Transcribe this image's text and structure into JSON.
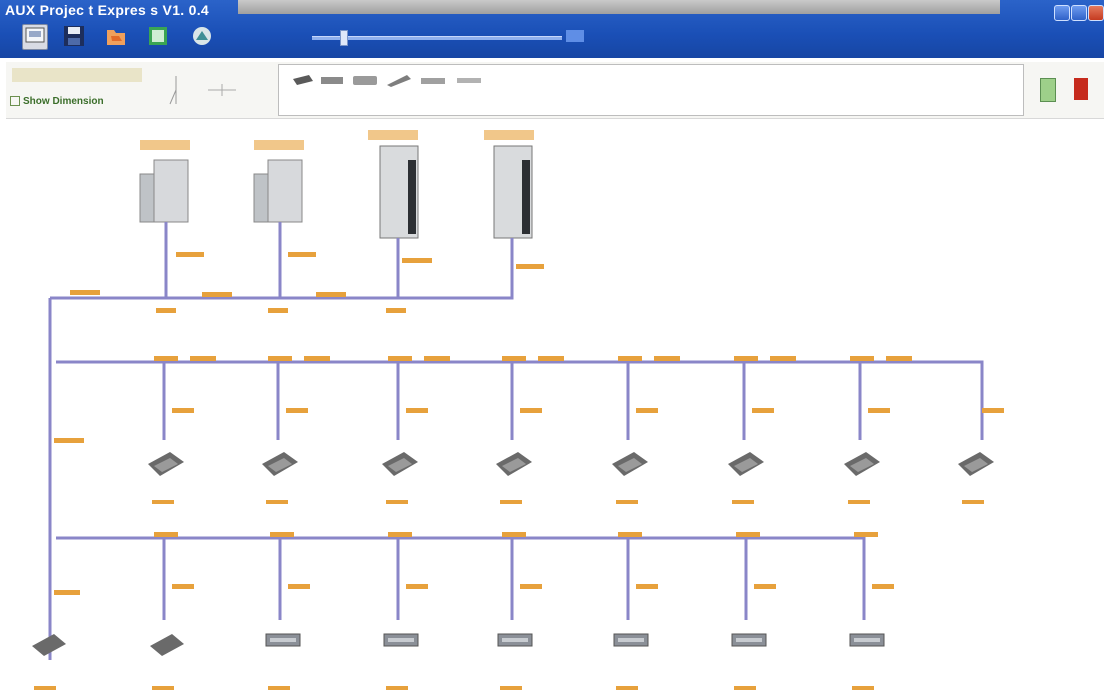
{
  "window": {
    "title": "AUX Projec t Expres s  V1. 0.4"
  },
  "toolbar": {
    "buttons": [
      {
        "name": "new-icon",
        "color": "#d5d9e3"
      },
      {
        "name": "save-icon",
        "color": "#1d2e5c"
      },
      {
        "name": "open-icon",
        "color": "#e36b2a"
      },
      {
        "name": "export-icon",
        "color": "#35a54d"
      },
      {
        "name": "settings-icon",
        "color": "#3f8f95"
      }
    ],
    "zoom_slider": {
      "value_fraction": 0.12
    }
  },
  "palette": {
    "show_dimension_label": "Show Dimension",
    "device_icons": [
      "cassette-unit-icon",
      "duct-unit-icon",
      "wall-unit-icon",
      "ceiling-unit-icon",
      "floor-unit-icon",
      "console-unit-icon"
    ],
    "tools": [
      "refresh-icon",
      "delete-icon"
    ]
  },
  "diagram": {
    "outdoor_units": 4,
    "row1_indoor_units": 8,
    "row2_indoor_units": 8,
    "pipe_color": "#8a86c8",
    "label_color": "#e7a13c"
  }
}
